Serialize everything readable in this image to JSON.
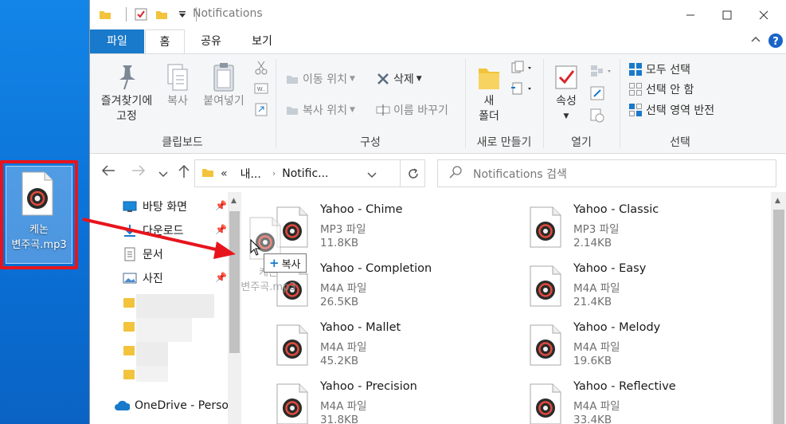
{
  "desktop": {
    "file_label_line1": "케논",
    "file_label_line2": "변주곡.mp3"
  },
  "window": {
    "title": "Notifications",
    "tabs": {
      "file": "파일",
      "home": "홈",
      "share": "공유",
      "view": "보기"
    }
  },
  "ribbon": {
    "clipboard": {
      "label": "클립보드",
      "pin_line1": "즐겨찾기에",
      "pin_line2": "고정",
      "copy": "복사",
      "paste": "붙여넣기"
    },
    "organize": {
      "label": "구성",
      "move_to": "이동 위치",
      "copy_to": "복사 위치",
      "delete": "삭제",
      "rename": "이름 바꾸기"
    },
    "new": {
      "label": "새로 만들기",
      "new_folder_line1": "새",
      "new_folder_line2": "폴더"
    },
    "open": {
      "label": "열기",
      "properties": "속성"
    },
    "select": {
      "label": "선택",
      "select_all": "모두 선택",
      "select_none": "선택 안 함",
      "invert": "선택 영역 반전"
    }
  },
  "address": {
    "prefix": "«",
    "crumb1": "내...",
    "crumb2": "Notific...",
    "search_placeholder": "Notifications 검색"
  },
  "nav": {
    "items": [
      {
        "label": "바탕 화면"
      },
      {
        "label": "다운로드"
      },
      {
        "label": "문서"
      },
      {
        "label": "사진"
      }
    ],
    "onedrive": "OneDrive - Person"
  },
  "files": [
    {
      "name": "Yahoo - Chime",
      "type": "MP3 파일",
      "size": "11.8KB"
    },
    {
      "name": "Yahoo - Classic",
      "type": "MP3 파일",
      "size": "2.14KB"
    },
    {
      "name": "Yahoo - Completion",
      "type": "M4A 파일",
      "size": "26.5KB"
    },
    {
      "name": "Yahoo - Easy",
      "type": "M4A 파일",
      "size": "21.4KB"
    },
    {
      "name": "Yahoo - Mallet",
      "type": "M4A 파일",
      "size": "45.2KB"
    },
    {
      "name": "Yahoo - Melody",
      "type": "M4A 파일",
      "size": "19.6KB"
    },
    {
      "name": "Yahoo - Precision",
      "type": "M4A 파일",
      "size": "31.8KB"
    },
    {
      "name": "Yahoo - Reflective",
      "type": "M4A 파일",
      "size": "33.4KB"
    }
  ],
  "drag": {
    "tooltip": "복사",
    "ghost_line1": "케논",
    "ghost_line2": "변주곡.mp3"
  },
  "colors": {
    "accent": "#1979ca",
    "desktop": "#0d74d8",
    "highlight": "#e8141c"
  }
}
